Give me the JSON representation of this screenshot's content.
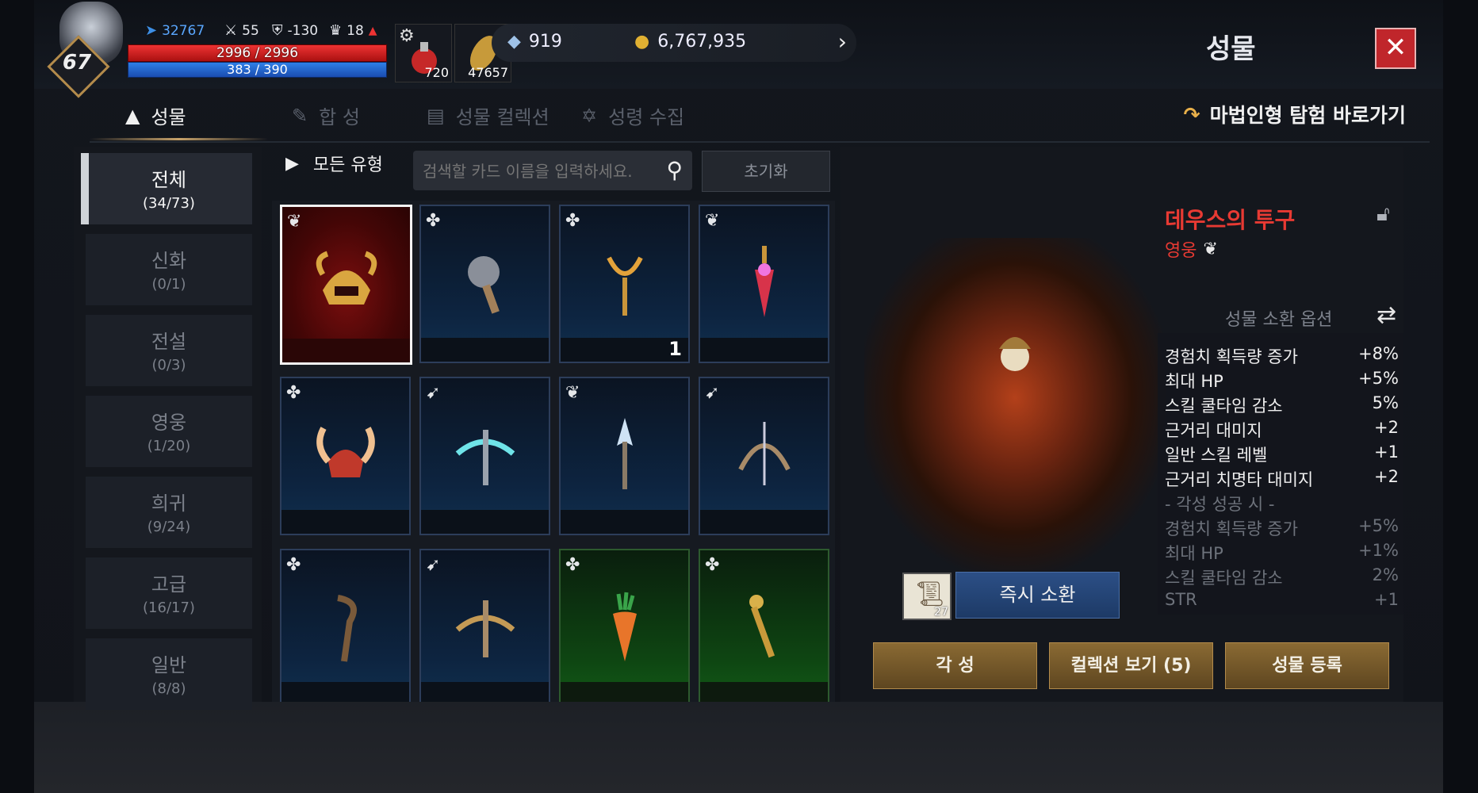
{
  "player": {
    "level": "67",
    "power": "32767",
    "stat_attack": "55",
    "stat_defense": "-130",
    "stat_trophy": "18",
    "hp": "2996 / 2996",
    "mp": "383 / 390",
    "potion_qty": "720",
    "feather_qty": "47657"
  },
  "currency": {
    "crystal": "919",
    "gold": "6,767,935"
  },
  "screen_title": "성물",
  "tabs": [
    {
      "label": "성물",
      "active": true
    },
    {
      "label": "합 성",
      "active": false
    },
    {
      "label": "성물 컬렉션",
      "active": false
    },
    {
      "label": "성령 수집",
      "active": false
    }
  ],
  "shortcut_label": "마법인형 탐험 바로가기",
  "categories": [
    {
      "name": "전체",
      "count": "(34/73)"
    },
    {
      "name": "신화",
      "count": "(0/1)"
    },
    {
      "name": "전설",
      "count": "(0/3)"
    },
    {
      "name": "영웅",
      "count": "(1/20)"
    },
    {
      "name": "희귀",
      "count": "(9/24)"
    },
    {
      "name": "고급",
      "count": "(16/17)"
    },
    {
      "name": "일반",
      "count": "(8/8)"
    }
  ],
  "filter": {
    "type_label": "모든 유형",
    "search_placeholder": "검색할 카드 이름을 입력하세요.",
    "reset_label": "초기화"
  },
  "cards": [
    {
      "icon": "helmet-icon",
      "count": ""
    },
    {
      "icon": "mace-icon",
      "count": ""
    },
    {
      "icon": "staff-icon",
      "count": "1"
    },
    {
      "icon": "amulet-icon",
      "count": ""
    },
    {
      "icon": "horned-helmet-icon",
      "count": ""
    },
    {
      "icon": "crossbow-icon",
      "count": ""
    },
    {
      "icon": "spear-icon",
      "count": ""
    },
    {
      "icon": "bow-icon",
      "count": ""
    },
    {
      "icon": "branch-staff-icon",
      "count": ""
    },
    {
      "icon": "crossbow-icon",
      "count": ""
    },
    {
      "icon": "carrot-icon",
      "count": ""
    },
    {
      "icon": "scepter-icon",
      "count": ""
    }
  ],
  "relic": {
    "name": "데우스의 투구",
    "grade": "영웅",
    "options_title": "성물 소환 옵션",
    "options": [
      {
        "label": "경험치 획득량 증가",
        "value": "+8%"
      },
      {
        "label": "최대 HP",
        "value": "+5%"
      },
      {
        "label": "스킬 쿨타임 감소",
        "value": "5%"
      },
      {
        "label": "근거리 대미지",
        "value": "+2"
      },
      {
        "label": "일반 스킬 레벨",
        "value": "+1"
      },
      {
        "label": "근거리 치명타 대미지",
        "value": "+2"
      }
    ],
    "awaken_header": "- 각성 성공 시 -",
    "awaken_options": [
      {
        "label": "경험치 획득량 증가",
        "value": "+5%"
      },
      {
        "label": "최대 HP",
        "value": "+1%"
      },
      {
        "label": "스킬 쿨타임 감소",
        "value": "2%"
      },
      {
        "label": "STR",
        "value": "+1"
      }
    ],
    "scroll_qty": "27",
    "summon_label": "즉시 소환"
  },
  "buttons": {
    "awaken": "각 성",
    "collection": "컬렉션 보기 (5)",
    "register": "성물 등록"
  },
  "colors": {
    "hero_red": "#e83a33",
    "close_red": "#c0262b",
    "gold_button": "#8a6a33",
    "summon_blue": "#2c4f86"
  }
}
